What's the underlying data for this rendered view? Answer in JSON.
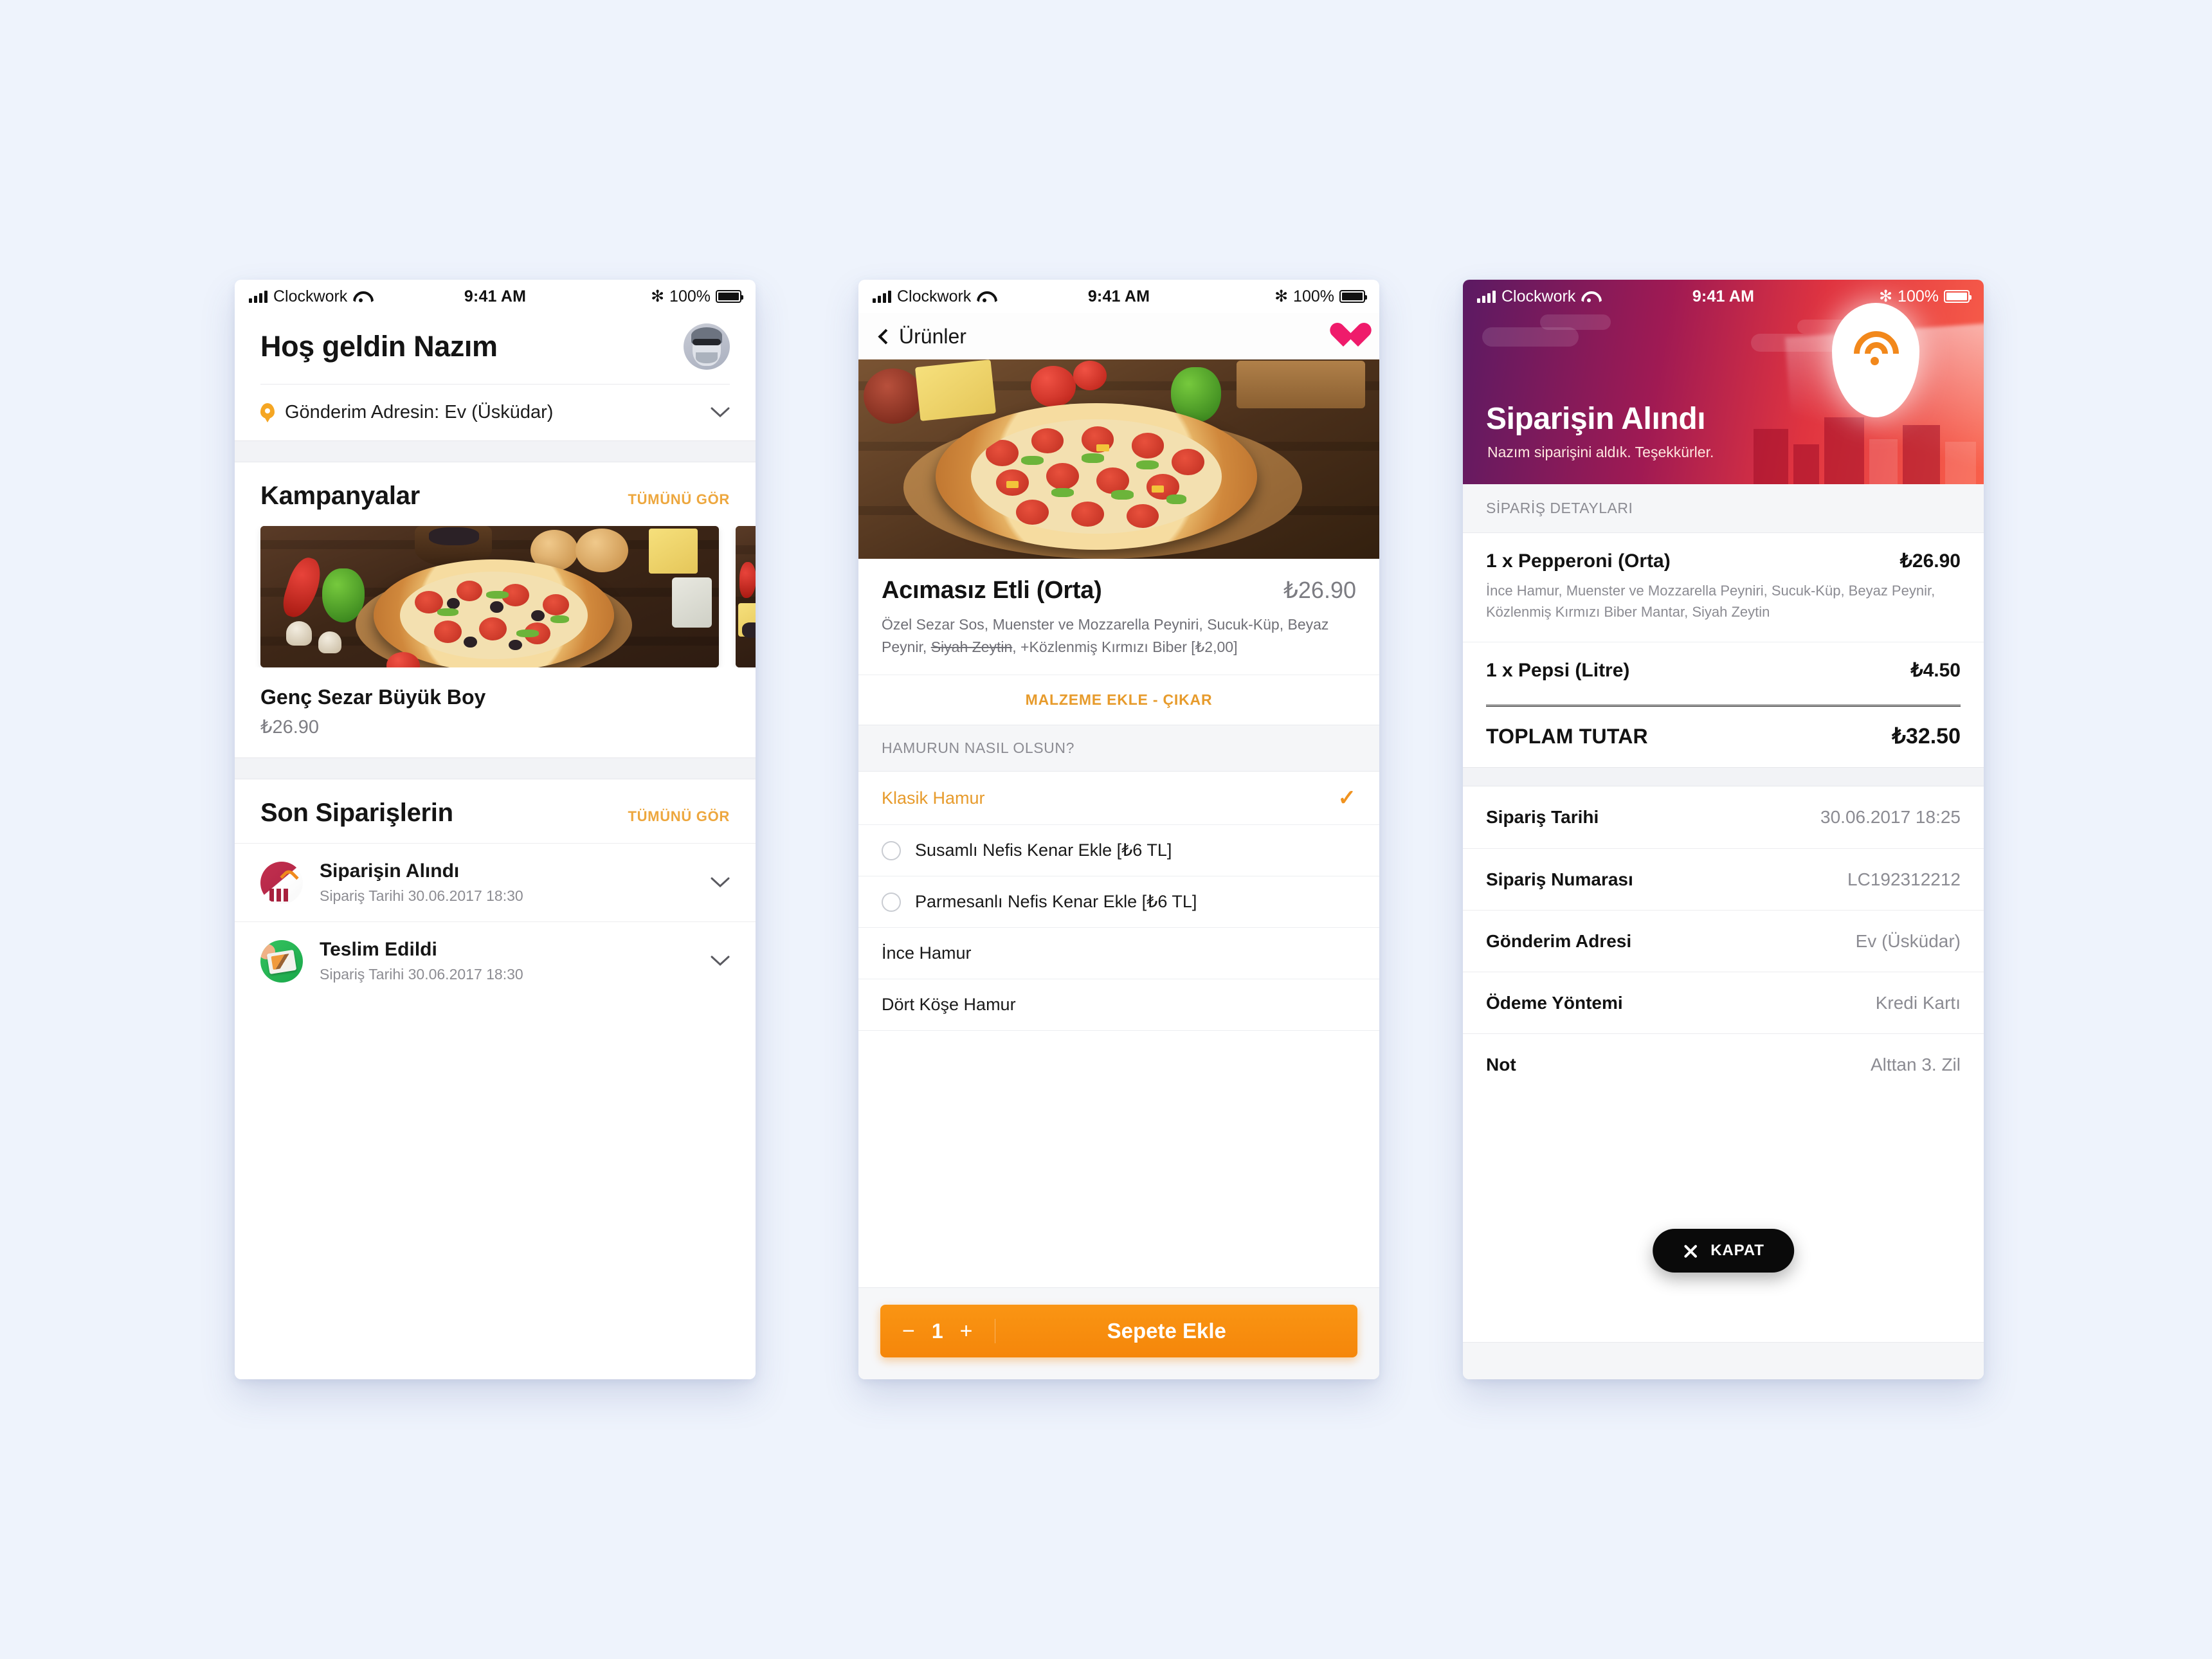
{
  "statusbar": {
    "carrier": "Clockwork",
    "time": "9:41 AM",
    "battery": "100%",
    "signal_icon": "signal-bars-icon",
    "wifi_icon": "wifi-icon",
    "bluetooth_icon": "bluetooth-icon",
    "battery_icon": "battery-icon"
  },
  "colors": {
    "accent_orange": "#f0931f",
    "link_gold": "#eda73e",
    "heart_pink": "#ef1b6b",
    "page_bg": "#eef3fc",
    "banner_from": "#5b1a63",
    "banner_to": "#f9604a"
  },
  "screen_home": {
    "greeting": "Hoş geldin Nazım",
    "avatar_alt": "user-avatar",
    "address_label": "Gönderim Adresin: Ev (Üsküdar)",
    "campaigns": {
      "title": "Kampanyalar",
      "see_all": "TÜMÜNÜ GÖR",
      "promo_title": "Genç Sezar Büyük Boy",
      "promo_price": "₺26.90"
    },
    "recent_orders": {
      "title": "Son Siparişlerin",
      "see_all": "TÜMÜNÜ GÖR",
      "items": [
        {
          "status": "Siparişin Alındı",
          "date": "Sipariş Tarihi 30.06.2017 18:30",
          "icon": "order-received-icon"
        },
        {
          "status": "Teslim Edildi",
          "date": "Sipariş Tarihi 30.06.2017 18:30",
          "icon": "order-delivered-icon"
        }
      ]
    }
  },
  "screen_product": {
    "back_label": "Ürünler",
    "favorite_icon": "heart-icon",
    "product_image_alt": "pepperoni-pizza-photo",
    "name": "Acımasız Etli (Orta)",
    "price": "₺26.90",
    "description_part1": "Özel Sezar Sos, Muenster ve Mozzarella Peyniri, Sucuk-Küp, Beyaz Peynir, ",
    "description_removed": "Siyah Zeytin",
    "description_part2": ", +Közlenmiş Kırmızı Biber [₺2,00]",
    "add_remove_link": "MALZEME EKLE - ÇIKAR",
    "dough_group_title": "HAMURUN NASIL OLSUN?",
    "dough_options": [
      {
        "label": "Klasik Hamur",
        "selected": true,
        "radio": false
      },
      {
        "label": "Susamlı Nefis Kenar Ekle [₺6 TL]",
        "selected": false,
        "radio": true
      },
      {
        "label": "Parmesanlı Nefis Kenar Ekle [₺6 TL]",
        "selected": false,
        "radio": true
      },
      {
        "label": "İnce Hamur",
        "selected": false,
        "radio": false
      },
      {
        "label": "Dört Köşe Hamur",
        "selected": false,
        "radio": false
      }
    ],
    "quantity": "1",
    "minus_label": "−",
    "plus_label": "+",
    "add_to_cart": "Sepete Ekle"
  },
  "screen_confirm": {
    "banner_title": "Siparişin Alındı",
    "banner_subtitle": "Nazım siparişini aldık. Teşekkürler.",
    "logo_icon": "pizza-pin-logo-icon",
    "details_label": "SİPARİŞ DETAYLARI",
    "items": [
      {
        "name": "1 x Pepperoni (Orta)",
        "price": "₺26.90",
        "description": "İnce Hamur, Muenster ve Mozzarella Peyniri, Sucuk-Küp, Beyaz Peynir, Közlenmiş Kırmızı Biber Mantar, Siyah Zeytin"
      },
      {
        "name": "1 x Pepsi (Litre)",
        "price": "₺4.50",
        "description": ""
      }
    ],
    "total_label": "TOPLAM TUTAR",
    "total_value": "₺32.50",
    "meta": [
      {
        "key": "Sipariş Tarihi",
        "value": "30.06.2017  18:25"
      },
      {
        "key": "Sipariş Numarası",
        "value": "LC192312212"
      },
      {
        "key": "Gönderim Adresi",
        "value": "Ev (Üsküdar)"
      },
      {
        "key": "Ödeme Yöntemi",
        "value": "Kredi Kartı"
      },
      {
        "key": "Not",
        "value": "Alttan 3. Zil"
      }
    ],
    "close_button": "KAPAT",
    "close_icon": "close-x-icon"
  }
}
